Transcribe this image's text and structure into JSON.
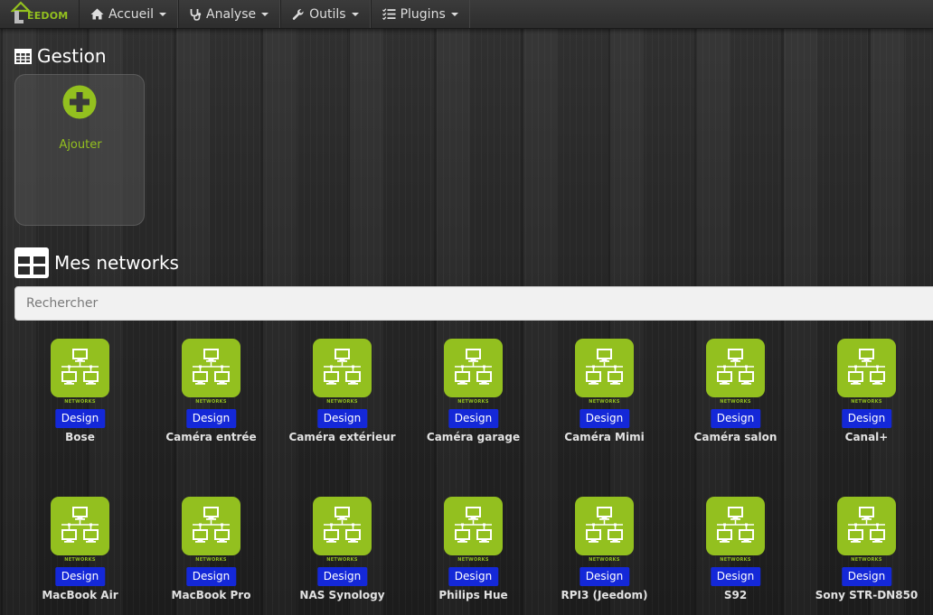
{
  "brand": {
    "text": "EEDOM",
    "accent": "#93c01f"
  },
  "nav": {
    "items": [
      {
        "label": "Accueil",
        "icon": "home-icon"
      },
      {
        "label": "Analyse",
        "icon": "stethoscope-icon"
      },
      {
        "label": "Outils",
        "icon": "wrench-icon"
      },
      {
        "label": "Plugins",
        "icon": "tasks-icon"
      }
    ]
  },
  "gestion": {
    "title": "Gestion",
    "add_label": "Ajouter",
    "add_icon": "plus-circle-icon"
  },
  "networks": {
    "title": "Mes networks",
    "search_placeholder": "Rechercher",
    "icon_caption": "NETWORKS",
    "badge_label": "Design",
    "badge_color": "#1428d8",
    "icon_color": "#93c01f",
    "items": [
      {
        "name": "Bose"
      },
      {
        "name": "Caméra entrée"
      },
      {
        "name": "Caméra extérieur"
      },
      {
        "name": "Caméra garage"
      },
      {
        "name": "Caméra Mimi"
      },
      {
        "name": "Caméra salon"
      },
      {
        "name": "Canal+"
      },
      {
        "name": "MacBook Air"
      },
      {
        "name": "MacBook Pro"
      },
      {
        "name": "NAS Synology"
      },
      {
        "name": "Philips Hue"
      },
      {
        "name": "RPI3 (Jeedom)"
      },
      {
        "name": "S92"
      },
      {
        "name": "Sony STR-DN850"
      }
    ]
  }
}
